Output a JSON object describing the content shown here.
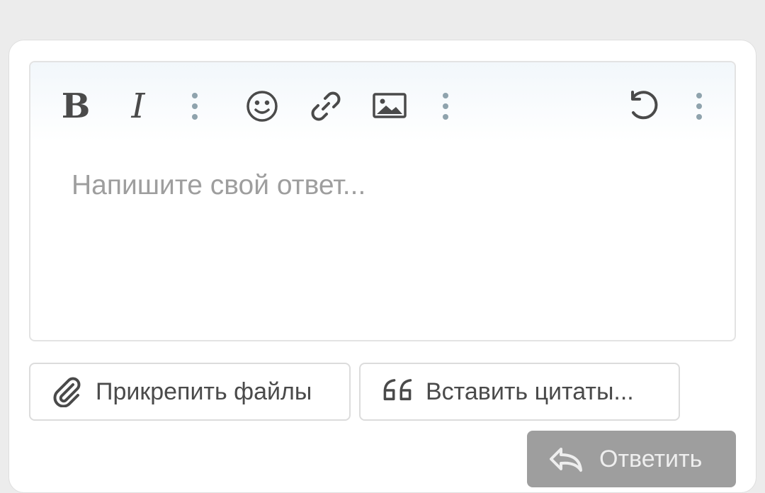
{
  "editor": {
    "placeholder": "Напишите свой ответ...",
    "toolbar": {
      "bold_label": "B",
      "italic_label": "I",
      "icons": [
        "more-vertical-icon",
        "smiley-icon",
        "link-icon",
        "image-icon",
        "more-vertical-icon",
        "undo-icon",
        "more-vertical-icon"
      ]
    }
  },
  "actions": {
    "attach_label": "Прикрепить файлы",
    "quote_label": "Вставить цитаты...",
    "reply_label": "Ответить"
  },
  "colors": {
    "icon": "#4a4a4a",
    "dots": "#8fa3ad",
    "placeholder": "#9e9e9e",
    "reply_button": "#9e9e9e"
  }
}
